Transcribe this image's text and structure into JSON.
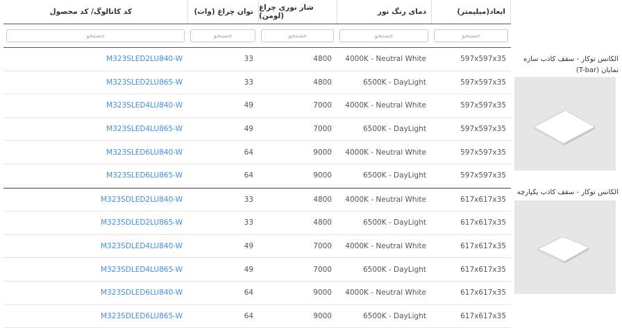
{
  "columns": {
    "dimensions": "ابعاد(میلیمتر)",
    "color_temp": "دمای رنگ نور",
    "luminous_flux": "شار نوری چراغ (لومن)",
    "power": "توان چراغ (وات)",
    "catalog_code": "کد کاتالوگ/ کد محصول"
  },
  "search_placeholder": "جستجو",
  "groups": [
    {
      "title": "الکانس توکار - سقف کاذب سازه نمایان (T-bar)",
      "image_icon": "square-panel-light-icon",
      "rows": [
        {
          "dim": "597x597x35",
          "temp": "4000K - Neutral White",
          "flux": "4800",
          "power": "33",
          "code": "M323SLED2LU840-W"
        },
        {
          "dim": "597x597x35",
          "temp": "6500K - DayLight",
          "flux": "4800",
          "power": "33",
          "code": "M323SLED2LU865-W"
        },
        {
          "dim": "597x597x35",
          "temp": "4000K - Neutral White",
          "flux": "7000",
          "power": "49",
          "code": "M323SLED4LU840-W"
        },
        {
          "dim": "597x597x35",
          "temp": "6500K - DayLight",
          "flux": "7000",
          "power": "49",
          "code": "M323SLED4LU865-W"
        },
        {
          "dim": "597x597x35",
          "temp": "4000K - Neutral White",
          "flux": "9000",
          "power": "64",
          "code": "M323SLED6LU840-W"
        },
        {
          "dim": "597x597x35",
          "temp": "6500K - DayLight",
          "flux": "9000",
          "power": "64",
          "code": "M323SLED6LU865-W"
        }
      ]
    },
    {
      "title": "الکانس توکار - سقف کاذب یکپارچه",
      "image_icon": "square-panel-light-icon",
      "rows": [
        {
          "dim": "617x617x35",
          "temp": "4000K - Neutral White",
          "flux": "4800",
          "power": "33",
          "code": "M323SDLED2LU840-W"
        },
        {
          "dim": "617x617x35",
          "temp": "6500K - DayLight",
          "flux": "4800",
          "power": "33",
          "code": "M323SDLED2LU865-W"
        },
        {
          "dim": "617x617x35",
          "temp": "4000K - Neutral White",
          "flux": "7000",
          "power": "49",
          "code": "M323SDLED4LU840-W"
        },
        {
          "dim": "617x617x35",
          "temp": "6500K - DayLight",
          "flux": "7000",
          "power": "49",
          "code": "M323SDLED4LU865-W"
        },
        {
          "dim": "617x617x35",
          "temp": "4000K - Neutral White",
          "flux": "9000",
          "power": "64",
          "code": "M323SDLED6LU840-W"
        },
        {
          "dim": "617x617x35",
          "temp": "6500K - DayLight",
          "flux": "9000",
          "power": "64",
          "code": "M323SDLED6LU865-W"
        }
      ]
    }
  ],
  "colors": {
    "link": "#3f8fe0",
    "header_border": "#555555",
    "image_bg": "#e6e6e6"
  }
}
